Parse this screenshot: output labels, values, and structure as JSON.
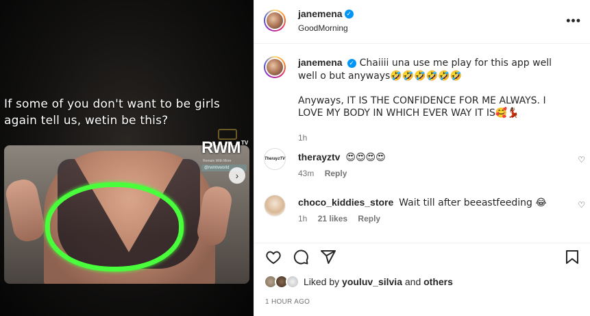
{
  "media": {
    "overlay_text_line1": "If some of you don't want to be girls",
    "overlay_text_line2": "again tell us, wetin be this?",
    "watermark": "RWM",
    "watermark_tv": "TV",
    "watermark_sub": "Remain With More",
    "watermark_handle": "@rwmtvworld",
    "next_icon": "chevron-right-icon",
    "highlight_color": "#49ff3c"
  },
  "header": {
    "username": "janemena",
    "subtitle": "GoodMorning",
    "more_icon": "more-horizontal-icon"
  },
  "caption": {
    "username": "janemena",
    "text_line1": "Chaiiii una use me play for this app well well o but anyways🤣🤣🤣🤣🤣🤣",
    "text_line2": "Anyways, IT IS THE CONFIDENCE FOR ME ALWAYS. I LOVE MY BODY IN WHICH EVER WAY IT IS🥰💃🏾",
    "time": "1h"
  },
  "comments": [
    {
      "username": "therayztv",
      "avatar_text": "TherayzTV",
      "text": "😍😍😍😍",
      "time": "43m",
      "likes": "",
      "reply": "Reply"
    },
    {
      "username": "choco_kiddies_store",
      "text": "Wait till after beeastfeeding 😂",
      "time": "1h",
      "likes": "21 likes",
      "reply": "Reply"
    }
  ],
  "actions": {
    "like_icon": "heart-icon",
    "comment_icon": "comment-icon",
    "share_icon": "share-icon",
    "save_icon": "bookmark-icon"
  },
  "likes": {
    "prefix": "Liked by",
    "user": "youluv_silvia",
    "joiner": "and",
    "others": "others"
  },
  "timestamp": "1 HOUR AGO",
  "colors": {
    "verified": "#0095f6",
    "muted": "#737373",
    "text": "#262626"
  }
}
